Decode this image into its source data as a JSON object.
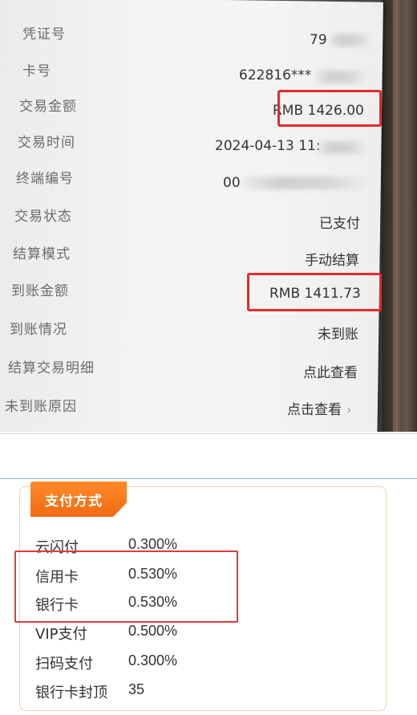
{
  "receipt": {
    "rows": [
      {
        "label": "凭证号",
        "value": "79",
        "blurred": true
      },
      {
        "label": "卡号",
        "value": "622816***",
        "blurred": true
      },
      {
        "label": "交易金额",
        "value": "RMB 1426.00",
        "blurred": false
      },
      {
        "label": "交易时间",
        "value": "2024-04-13 11:",
        "blurred": true
      },
      {
        "label": "终端编号",
        "value": "00",
        "blurred": true
      },
      {
        "label": "交易状态",
        "value": "已支付",
        "blurred": false
      },
      {
        "label": "结算模式",
        "value": "手动结算",
        "blurred": false
      },
      {
        "label": "到账金额",
        "value": "RMB 1411.73",
        "blurred": false
      },
      {
        "label": "到账情况",
        "value": "未到账",
        "blurred": false
      },
      {
        "label": "结算交易明细",
        "value": "点此查看",
        "blurred": false
      },
      {
        "label": "未到账原因",
        "value": "点击查看",
        "blurred": false
      }
    ],
    "chevron": "›"
  },
  "fees": {
    "tab_title": "支付方式",
    "items": [
      {
        "name": "云闪付",
        "rate": "0.300%"
      },
      {
        "name": "信用卡",
        "rate": "0.530%"
      },
      {
        "name": "银行卡",
        "rate": "0.530%"
      },
      {
        "name": "VIP支付",
        "rate": "0.500%"
      },
      {
        "name": "扫码支付",
        "rate": "0.300%"
      },
      {
        "name": "银行卡封顶",
        "rate": "35"
      }
    ]
  },
  "colors": {
    "highlight": "#e62a2a",
    "tab_orange": "#f26a12",
    "card_border": "#e8d3b8"
  }
}
